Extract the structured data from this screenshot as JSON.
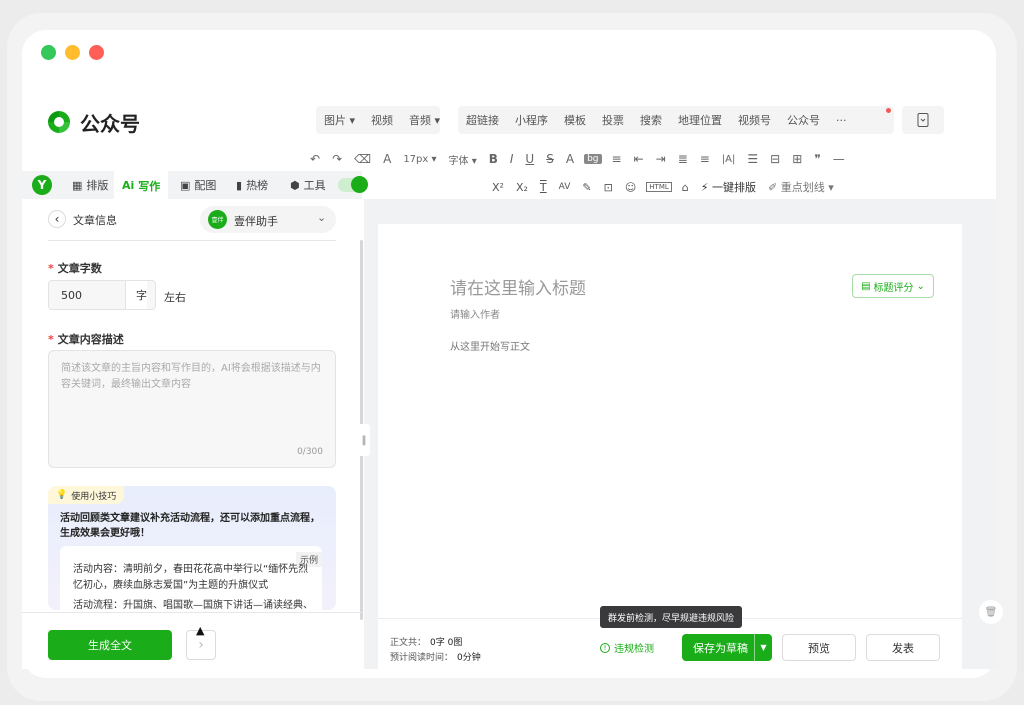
{
  "window": {
    "controls": {
      "green": "#34c759",
      "yellow": "#ffbd2e",
      "red": "#ff5f57"
    },
    "brand": "公众号",
    "accent": "#1aad19"
  },
  "insert_bar": {
    "group1": [
      "图片",
      "视频",
      "音频"
    ],
    "group2": [
      "超链接",
      "小程序",
      "模板",
      "投票",
      "搜索",
      "地理位置",
      "视频号",
      "公众号",
      "···"
    ]
  },
  "format_bar": {
    "row1": [
      "↶",
      "↷",
      "⌫",
      "A",
      "17px",
      "字体",
      "B",
      "I",
      "U",
      "S",
      "A",
      "bg",
      "≡",
      "⇤",
      "⇥",
      "≣",
      "≡",
      "|A|",
      "☰",
      "⊟",
      "⊞",
      "❞",
      "—"
    ],
    "row2": [
      "X²",
      "X₂",
      "T",
      "AV",
      "✎",
      "⊡",
      "☺",
      "HTML",
      "⌂",
      "⚡ 一键排版",
      "✐ 重点划线"
    ]
  },
  "sidebar": {
    "tabs": [
      {
        "label": "排版",
        "icon": "layout-icon"
      },
      {
        "label": "写作",
        "icon": "ai-write-icon",
        "active": true
      },
      {
        "label": "配图",
        "icon": "image-icon"
      },
      {
        "label": "热榜",
        "icon": "hot-list-icon"
      },
      {
        "label": "工具",
        "icon": "tools-icon"
      }
    ],
    "header": {
      "back": "‹",
      "title": "文章信息",
      "assistant_badge": "壹伴",
      "assistant": "壹伴助手"
    },
    "word_count": {
      "label": "文章字数",
      "value": "500",
      "unit": "字",
      "suffix": "左右"
    },
    "description": {
      "label": "文章内容描述",
      "placeholder": "简述该文章的主旨内容和写作目的，AI将会根据该描述与内容关键词，最终输出文章内容",
      "counter": "0/300"
    },
    "tip": {
      "tag": "使用小技巧",
      "headline": "活动回顾类文章建议补充活动流程，还可以添加重点流程，生成效果会更好哦！",
      "example_badge": "示例",
      "example_lines": [
        "活动内容：清明前夕，春田花花高中举行以“缅怀先烈 忆初心，赓续血脉志爱国”为主题的升旗仪式",
        "活动流程：升国旗、唱国歌—国旗下讲话—诵读经典、"
      ]
    },
    "generate_button": "生成全文",
    "next_button": "›"
  },
  "editor": {
    "title_placeholder": "请在这里输入标题",
    "author_placeholder": "请输入作者",
    "body_placeholder": "从这里开始写正文",
    "title_score": "标题评分",
    "resize_handle": "‖"
  },
  "footer": {
    "stats_label": "正文共：",
    "stats_value": "0字 0图",
    "read_label": "预计阅读时间：",
    "read_value": "0分钟",
    "tooltip": "群发前检测，尽早规避违规风险",
    "check": "违规检测",
    "save_draft": "保存为草稿",
    "preview": "预览",
    "publish": "发表"
  }
}
